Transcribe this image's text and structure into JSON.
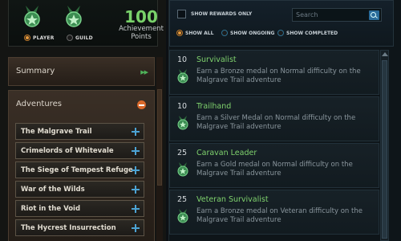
{
  "header": {
    "player_label": "PLAYER",
    "guild_label": "GUILD",
    "selected_owner": "PLAYER",
    "points_value": "100",
    "points_label": "Achievement Points"
  },
  "sidebar": {
    "summary_label": "Summary",
    "adventures_label": "Adventures",
    "adventures": [
      {
        "label": "The Malgrave Trail"
      },
      {
        "label": "Crimelords of Whitevale"
      },
      {
        "label": "The Siege of Tempest Refuge"
      },
      {
        "label": "War of the Wilds"
      },
      {
        "label": "Riot in the Void"
      },
      {
        "label": "The Hycrest Insurrection"
      }
    ]
  },
  "filters": {
    "show_rewards_only_label": "SHOW REWARDS ONLY",
    "search_placeholder": "Search",
    "show_all_label": "SHOW ALL",
    "show_ongoing_label": "SHOW ONGOING",
    "show_completed_label": "SHOW COMPLETED",
    "selected": "SHOW ALL"
  },
  "achievements": [
    {
      "points": "10",
      "name": "Survivalist",
      "description": "Earn a Bronze medal on Normal difficulty on the Malgrave Trail adventure",
      "medal": "bronze-medal-icon"
    },
    {
      "points": "10",
      "name": "Trailhand",
      "description": "Earn a Silver Medal on Normal difficulty on the Malgrave Trail adventure",
      "medal": "silver-medal-icon"
    },
    {
      "points": "25",
      "name": "Caravan Leader",
      "description": "Earn a Gold medal on Normal difficulty on the Malgrave Trail adventure",
      "medal": "gold-medal-icon"
    },
    {
      "points": "25",
      "name": "Veteran Survivalist",
      "description": "Earn a Bronze medal on Veteran difficulty on the Malgrave Trail adventure",
      "medal": "bronze-medal-icon"
    }
  ],
  "colors": {
    "accent_green": "#79d26a",
    "accent_orange": "#e89a3a",
    "accent_blue": "#4ca3d4"
  }
}
